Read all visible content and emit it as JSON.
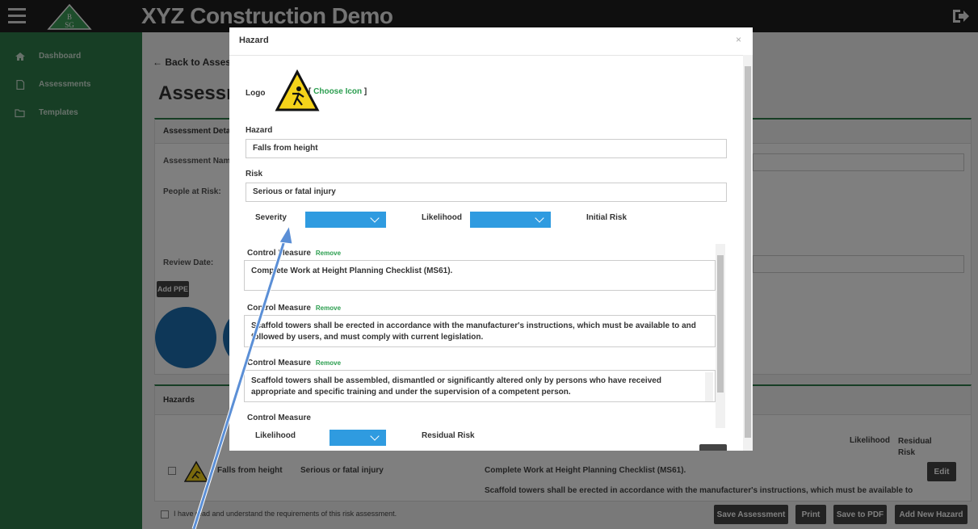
{
  "header": {
    "app_title": "XYZ Construction Demo",
    "logo_text": "BSG"
  },
  "sidebar": {
    "items": [
      {
        "label": "Dashboard",
        "icon": "dashboard-icon"
      },
      {
        "label": "Assessments",
        "icon": "document-icon"
      },
      {
        "label": "Templates",
        "icon": "folder-icon"
      }
    ]
  },
  "page": {
    "back_link": "← Back to Assessm",
    "heading": "Assessmer",
    "details_panel_title": "Assessment Details",
    "assessment_name_label": "Assessment Name:",
    "people_at_risk_label": "People at Risk:",
    "review_date_label": "Review Date:",
    "add_ppe_label": "Add PPE",
    "hazards_panel_title": "Hazards",
    "col_likelihood": "Likelihood",
    "col_residual_risk": "Residual Risk",
    "row_hazard": "Falls from height",
    "row_risk": "Serious or fatal injury",
    "row_measure_1": "Complete Work at Height Planning Checklist (MS61).",
    "row_measure_2": "Scaffold towers shall be erected in accordance with the manufacturer's instructions, which must be available to",
    "edit_label": "Edit",
    "confirm_text": "I have read and understand the requirements of this risk assessment.",
    "save_assessment": "Save Assessment",
    "print": "Print",
    "save_pdf": "Save to PDF",
    "add_new_hazard": "Add New Hazard"
  },
  "modal": {
    "title": "Hazard",
    "close": "×",
    "logo_label": "Logo",
    "choose_icon_open": "[",
    "choose_icon": "Choose Icon",
    "choose_icon_close": "]",
    "hazard_label": "Hazard",
    "hazard_value": "Falls from height",
    "risk_label": "Risk",
    "risk_value": "Serious or fatal injury",
    "severity_label": "Severity",
    "likelihood_label": "Likelihood",
    "initial_risk_label": "Initial Risk",
    "control_measures": [
      {
        "label": "Control Measure",
        "remove": "Remove",
        "text": "Complete Work at Height Planning Checklist (MS61)."
      },
      {
        "label": "Control Measure",
        "remove": "Remove",
        "text": "Scaffold towers shall be erected in accordance with the manufacturer's instructions, which must be available to and followed by users, and must comply with current legislation."
      },
      {
        "label": "Control Measure",
        "remove": "Remove",
        "text": "Scaffold towers shall be assembled, dismantled or significantly altered only by persons who have received appropriate and specific training and under the supervision of a competent person."
      },
      {
        "label": "Control Measure"
      }
    ],
    "likelihood2_label": "Likelihood",
    "residual_risk_label": "Residual Risk"
  },
  "colors": {
    "sidebar": "#2f7d4a",
    "topbar": "#1f1f1f",
    "accent_green": "#2a9d4e",
    "dropdown_blue": "#2f9be0",
    "ppe_blue": "#1d6fb0",
    "annotation_arrow": "#5b8fd6"
  }
}
